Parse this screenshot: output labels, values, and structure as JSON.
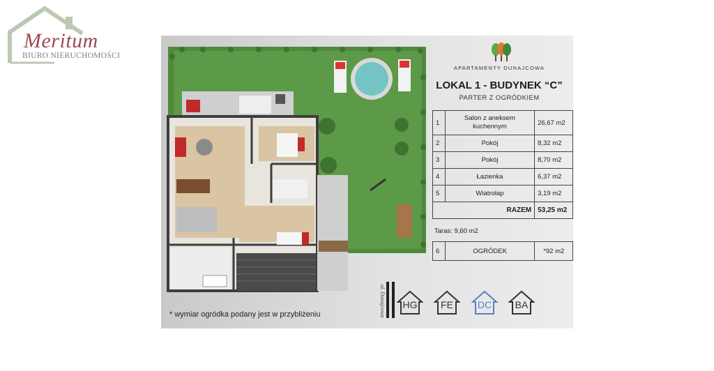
{
  "agency": {
    "name": "Meritum",
    "subtitle": "BIURO NIERUCHOMOŚCI"
  },
  "project": {
    "name": "APARTAMENTY DUNAJCOWA"
  },
  "unit": {
    "title": "LOKAL 1 - BUDYNEK “C”",
    "subtitle": "PARTER Z OGRÓDKIEM"
  },
  "rooms": [
    {
      "num": "1",
      "name": "Salon z aneksem kuchennym",
      "area": "26,67 m2"
    },
    {
      "num": "2",
      "name": "Pokój",
      "area": "8,32 m2"
    },
    {
      "num": "3",
      "name": "Pokój",
      "area": "8,70 m2"
    },
    {
      "num": "4",
      "name": "Łazienka",
      "area": "6,37 m2"
    },
    {
      "num": "5",
      "name": "Wiatrołap",
      "area": "3,19 m2"
    }
  ],
  "total": {
    "label": "RAZEM",
    "area": "53,25 m2"
  },
  "terrace": "Taras:  9,60 m2",
  "garden": {
    "num": "6",
    "name": "OGRÓDEK",
    "area": "*92 m2"
  },
  "street_label": "ul. Dunajcowa",
  "buildings": [
    {
      "label": "HG",
      "active": false
    },
    {
      "label": "FE",
      "active": false
    },
    {
      "label": "DC",
      "active": true
    },
    {
      "label": "BA",
      "active": false
    }
  ],
  "footnote": "* wymiar ogródka podany jest w przybliżeniu",
  "colors": {
    "brand": "#9b4a52",
    "grass": "#4f8a3c",
    "active_building": "#5b7fc4"
  }
}
